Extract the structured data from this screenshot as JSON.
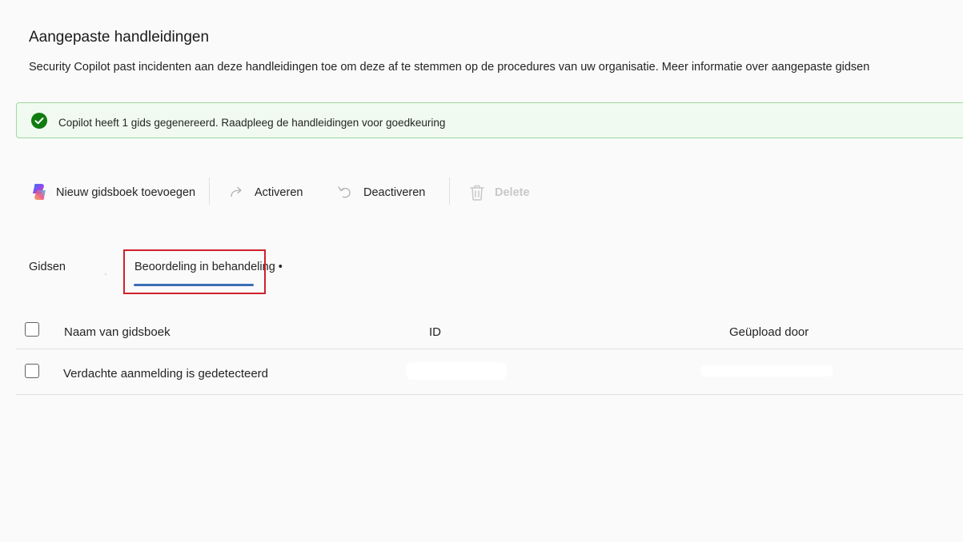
{
  "page": {
    "title": "Aangepaste handleidingen",
    "description": "Security Copilot past incidenten aan deze handleidingen toe om deze af te stemmen op de procedures van uw organisatie.",
    "learn_more": "Meer informatie over aangepaste gidsen"
  },
  "banner": {
    "icon": "checkmark-circle-icon",
    "message": "Copilot heeft 1 gids gegenereerd. Raadpleeg de handleidingen voor goedkeuring",
    "color": "#107c10"
  },
  "toolbar": {
    "add_label": "Nieuw gidsboek toevoegen",
    "activate_label": "Activeren",
    "deactivate_label": "Deactiveren",
    "delete_label": "Delete"
  },
  "tabs": {
    "guides": "Gidsen",
    "pending": "Beoordeling in behandeling •"
  },
  "table": {
    "columns": [
      "Naam van gidsboek",
      "ID",
      "Geüpload door"
    ],
    "rows": [
      {
        "name": "Verdachte aanmelding is gedetecteerd"
      }
    ]
  },
  "colors": {
    "accent": "#3a6db5",
    "highlight": "#d0202c",
    "success": "#107c10"
  }
}
